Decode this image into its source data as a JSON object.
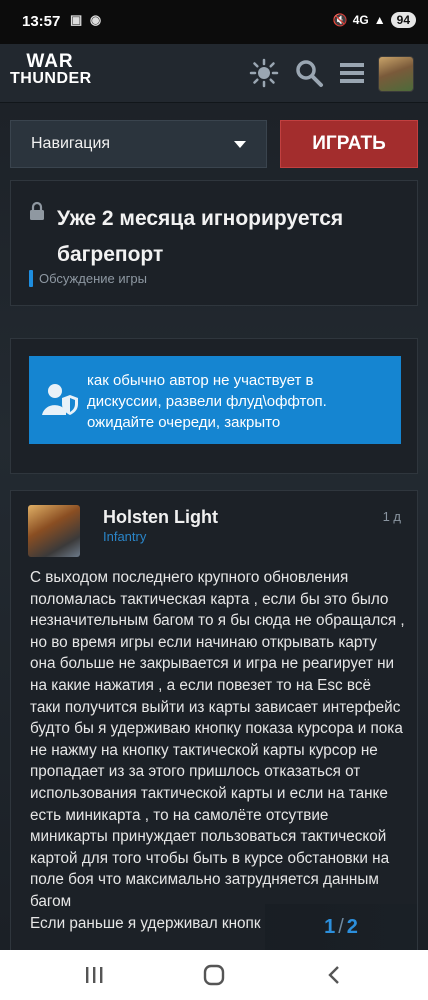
{
  "statusbar": {
    "time": "13:57",
    "battery": "94",
    "network": "4G"
  },
  "header": {
    "logo_line1": "WAR",
    "logo_line2": "THUNDER"
  },
  "navigation": {
    "select_label": "Навигация",
    "play_label": "ИГРАТЬ"
  },
  "topic": {
    "title": "Уже 2 месяца игнорируется багрепорт",
    "category": "Обсуждение игры",
    "category_color": "#1e8ee0"
  },
  "notice": {
    "text": "как обычно автор не участвует в дискуссии, развели флуд\\оффтоп. ожидайте очереди, закрыто",
    "color": "#1585d1"
  },
  "post": {
    "username": "Holsten Light",
    "user_title": "Infantry",
    "time": "1 д",
    "body": "С выходом последнего крупного обновления поломалась тактическая карта , если бы это было незначительным багом то я бы сюда не обращался , но во время игры если начинаю открывать карту она больше не закрывается и игра не реагирует ни на какие нажатия , а если повезет то на Esc всё таки получится выйти из карты зависает интерфейс будто бы я удерживаю кнопку показа курсора и пока не нажму на кнопку тактической карты курсор не пропадает из за этого пришлось отказаться от использования тактической карты и если на танке есть миникарта , то на самолёте отсутвие миникарты принуждает пользоваться тактической картой для того чтобы быть в курсе обстановки на поле боя что максимально затрудняется данным багом",
    "body_cont": "Если раньше я удерживал кнопк"
  },
  "progress": {
    "current": "1",
    "total": "2",
    "accent": "#2c8fdc"
  },
  "accent_colors": {
    "play_button": "#a32d2d",
    "background": "#181c21"
  }
}
